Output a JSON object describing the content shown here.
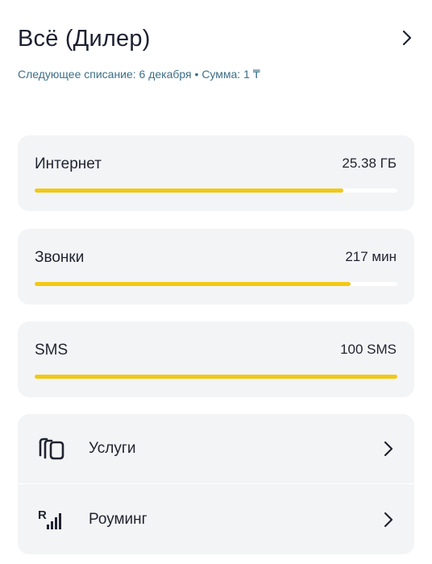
{
  "header": {
    "title": "Всё (Дилер)",
    "subtitle": "Следующее списание: 6 декабря • Сумма: 1 ₸"
  },
  "usage": [
    {
      "label": "Интернет",
      "value": "25.38 ГБ",
      "fill_fraction": 0.85
    },
    {
      "label": "Звонки",
      "value": "217 мин",
      "fill_fraction": 0.87
    },
    {
      "label": "SMS",
      "value": "100 SMS",
      "fill_fraction": 1.0
    }
  ],
  "menu": [
    {
      "label": "Услуги",
      "icon": "services-icon"
    },
    {
      "label": "Роуминг",
      "icon": "roaming-signal-icon"
    }
  ],
  "colors": {
    "accent_bar": "#f2c812",
    "card_bg": "#f3f4f6",
    "subtitle_text": "#3c6f86",
    "primary_text": "#1f2330"
  }
}
